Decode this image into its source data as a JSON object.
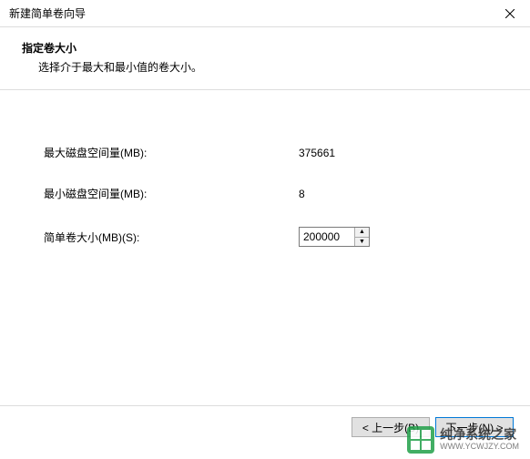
{
  "window": {
    "title": "新建简单卷向导"
  },
  "header": {
    "title": "指定卷大小",
    "description": "选择介于最大和最小值的卷大小。"
  },
  "fields": {
    "max": {
      "label": "最大磁盘空间量(MB):",
      "value": "375661"
    },
    "min": {
      "label": "最小磁盘空间量(MB):",
      "value": "8"
    },
    "size": {
      "label": "简单卷大小(MB)(S):",
      "value": "200000"
    }
  },
  "buttons": {
    "back": "< 上一步(B)",
    "next": "下一步(N) >"
  },
  "watermark": {
    "line1": "纯净系统之家",
    "line2": "WWW.YCWJZY.COM"
  }
}
